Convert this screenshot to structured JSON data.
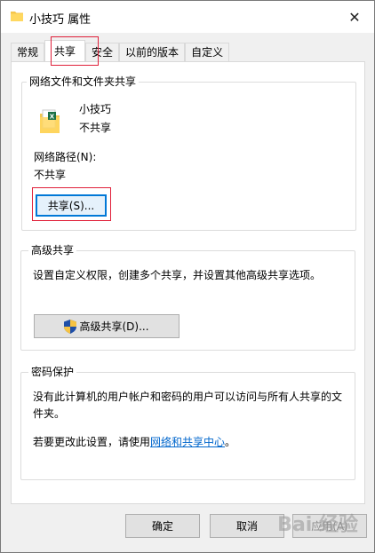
{
  "window": {
    "title": "小技巧 属性",
    "close_glyph": "✕"
  },
  "tabs": [
    {
      "label": "常规",
      "active": false
    },
    {
      "label": "共享",
      "active": true
    },
    {
      "label": "安全",
      "active": false
    },
    {
      "label": "以前的版本",
      "active": false
    },
    {
      "label": "自定义",
      "active": false
    }
  ],
  "network_sharing": {
    "group_title": "网络文件和文件夹共享",
    "item_name": "小技巧",
    "item_status": "不共享",
    "path_label": "网络路径(N):",
    "path_value": "不共享",
    "share_button": "共享(S)..."
  },
  "advanced_sharing": {
    "group_title": "高级共享",
    "description": "设置自定义权限，创建多个共享，并设置其他高级共享选项。",
    "button": "高级共享(D)..."
  },
  "password_protection": {
    "group_title": "密码保护",
    "description_line1": "没有此计算机的用户帐户和密码的用户可以访问与所有人共享的文",
    "description_line2": "件夹。",
    "change_prefix": "若要更改此设置，请使用",
    "change_link": "网络和共享中心",
    "change_suffix": "。"
  },
  "footer": {
    "ok": "确定",
    "cancel": "取消",
    "apply": "应用(A)"
  },
  "watermark": "Bai 经验",
  "colors": {
    "highlight": "#e0203a",
    "link": "#0066cc",
    "focus": "#0078d7"
  }
}
